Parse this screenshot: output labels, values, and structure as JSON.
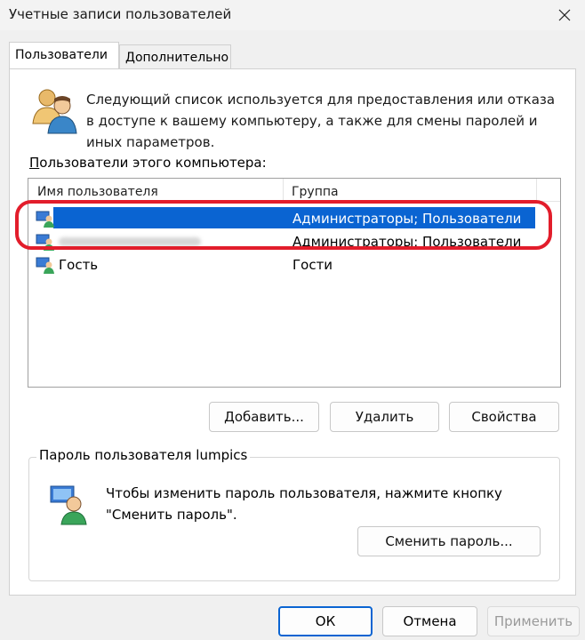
{
  "window": {
    "title": "Учетные записи пользователей"
  },
  "tabs": [
    {
      "label": "Пользователи"
    },
    {
      "label": "Дополнительно"
    }
  ],
  "intro": {
    "text": "Следующий список используется для предоставления или отказа в доступе к вашему компьютеру, а также для смены паролей и иных параметров."
  },
  "users_list": {
    "label_first": "П",
    "label_rest": "ользователи этого компьютера:",
    "columns": [
      "Имя пользователя",
      "Группа"
    ],
    "rows": [
      {
        "name": "",
        "group": "Администраторы; Пользователи"
      },
      {
        "name": "",
        "group": "Администраторы; Пользователи"
      },
      {
        "name": "Гость",
        "group": "Гости"
      }
    ]
  },
  "buttons": {
    "add": "Добавить...",
    "remove": "Удалить",
    "properties": "Свойства"
  },
  "password_group": {
    "title": "Пароль пользователя lumpics",
    "text": "Чтобы изменить пароль пользователя, нажмите кнопку \"Сменить пароль\".",
    "change_button": "Сменить пароль..."
  },
  "footer": {
    "ok": "ОК",
    "cancel": "Отмена",
    "apply": "Применить"
  },
  "colors": {
    "selection": "#0a64d2",
    "highlight": "#e21d2b"
  }
}
